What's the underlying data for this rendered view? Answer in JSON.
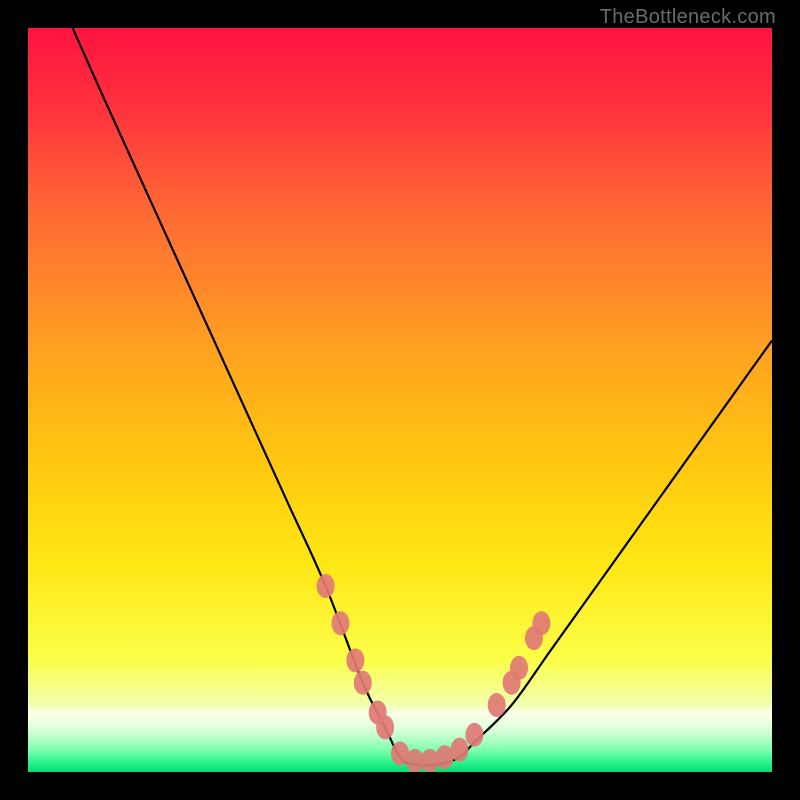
{
  "watermark": "TheBottleneck.com",
  "chart_data": {
    "type": "line",
    "title": "",
    "xlabel": "",
    "ylabel": "",
    "xlim": [
      0,
      100
    ],
    "ylim": [
      0,
      100
    ],
    "grid": false,
    "legend": false,
    "background_bands": [
      {
        "name": "red",
        "y_from": 100,
        "y_to": 60,
        "color_top": "#ff1a3e",
        "color_bottom": "#ff7a2a"
      },
      {
        "name": "orange",
        "y_from": 60,
        "y_to": 35,
        "color_top": "#ff7a2a",
        "color_bottom": "#ffd20a"
      },
      {
        "name": "yellow",
        "y_from": 35,
        "y_to": 10,
        "color_top": "#ffd20a",
        "color_bottom": "#f9ff55"
      },
      {
        "name": "pale",
        "y_from": 10,
        "y_to": 4,
        "color_top": "#f9ff55",
        "color_bottom": "#e9ffd0"
      },
      {
        "name": "green",
        "y_from": 4,
        "y_to": 0,
        "color_top": "#8fffac",
        "color_bottom": "#00e574"
      }
    ],
    "series": [
      {
        "name": "curve",
        "color": "#000000",
        "x": [
          6,
          10,
          15,
          20,
          25,
          30,
          35,
          40,
          45,
          48,
          50,
          52,
          55,
          58,
          60,
          65,
          70,
          75,
          80,
          85,
          90,
          95,
          100
        ],
        "y": [
          100,
          91,
          80,
          69,
          58,
          47,
          36,
          25,
          12,
          6,
          2,
          1,
          1,
          2,
          4,
          9,
          16,
          23,
          30,
          37,
          44,
          51,
          58
        ]
      }
    ],
    "markers": {
      "name": "highlighted-points",
      "color": "#e07a74",
      "points": [
        {
          "x": 40,
          "y": 25
        },
        {
          "x": 42,
          "y": 20
        },
        {
          "x": 44,
          "y": 15
        },
        {
          "x": 45,
          "y": 12
        },
        {
          "x": 47,
          "y": 8
        },
        {
          "x": 48,
          "y": 6
        },
        {
          "x": 50,
          "y": 2.5
        },
        {
          "x": 52,
          "y": 1.5
        },
        {
          "x": 54,
          "y": 1.5
        },
        {
          "x": 56,
          "y": 2
        },
        {
          "x": 58,
          "y": 3
        },
        {
          "x": 60,
          "y": 5
        },
        {
          "x": 63,
          "y": 9
        },
        {
          "x": 65,
          "y": 12
        },
        {
          "x": 66,
          "y": 14
        },
        {
          "x": 68,
          "y": 18
        },
        {
          "x": 69,
          "y": 20
        }
      ]
    }
  }
}
